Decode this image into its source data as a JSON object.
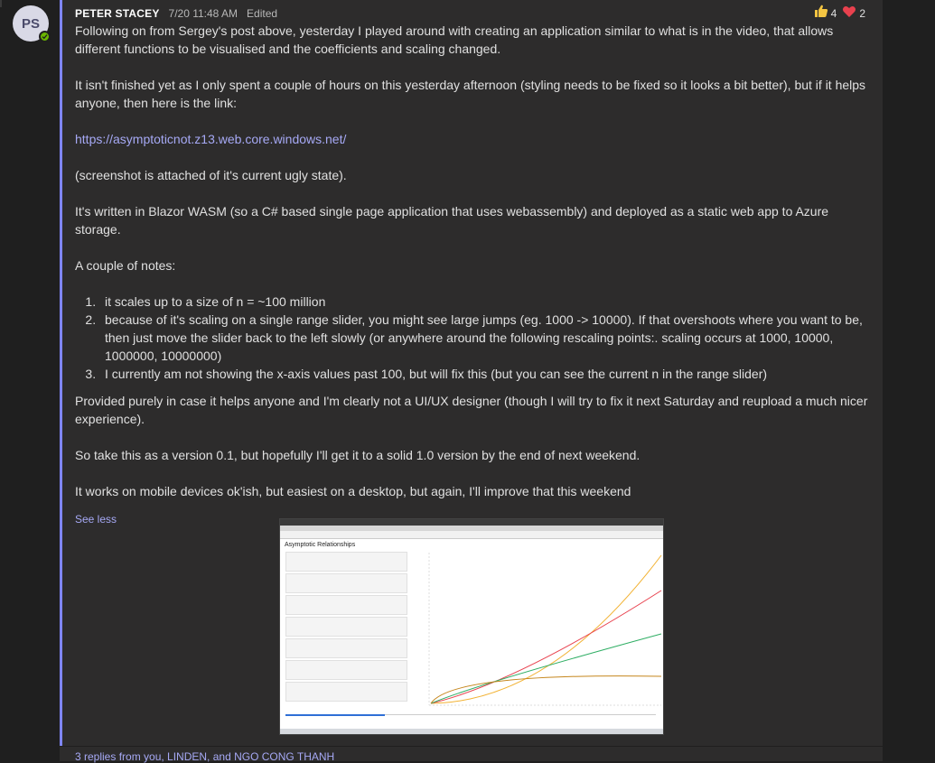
{
  "message": {
    "avatar_initials": "PS",
    "author": "PETER STACEY",
    "timestamp": "7/20 11:48 AM",
    "edited_label": "Edited",
    "reactions": [
      {
        "icon": "thumbs-up-icon",
        "count": "4"
      },
      {
        "icon": "heart-icon",
        "count": "2"
      }
    ],
    "paragraphs": {
      "p1": "Following on from Sergey's post above, yesterday I played around with creating an application similar to what is in the video, that allows different functions to be visualised and the coefficients and scaling changed.",
      "p2": "It isn't finished yet as I only spent a couple of hours on this yesterday afternoon (styling needs to be fixed so it looks a bit better), but if it helps anyone, then here is the link:",
      "link": "https://asymptoticnot.z13.web.core.windows.net/",
      "p3": "(screenshot is attached of it's current ugly state).",
      "p4": "It's written in Blazor WASM (so a C# based single page application that uses webassembly) and deployed as a static web app to Azure storage.",
      "p5": "A couple of notes:",
      "p6": "Provided purely in case it helps anyone and I'm clearly not a UI/UX designer (though I will try to fix it next Saturday and reupload a much nicer experience).",
      "p7": "So take this as a version 0.1, but hopefully I'll get it to a solid 1.0 version by the end of next weekend.",
      "p8": "It works on mobile devices ok'ish, but easiest on a desktop, but again, I'll improve that this weekend"
    },
    "notes": [
      "it scales up to a size of n = ~100 million",
      "because of it's scaling on a single range slider, you might see large jumps (eg. 1000 -> 10000). If that overshoots where you want to be, then just move the slider back to the left slowly (or anywhere around the following rescaling points:. scaling occurs at 1000, 10000, 1000000, 10000000)",
      "I currently am not showing the x-axis values past 100, but will fix this (but you can see the current n in the range slider)"
    ],
    "see_less": "See less",
    "attachment": {
      "heading": "Asymptotic Relationships",
      "line_colors": [
        "#f2b233",
        "#e8414e",
        "#2fae64",
        "#c5861c"
      ]
    },
    "replies_label": "3 replies from you, LINDEN, and NGO CONG THANH"
  }
}
